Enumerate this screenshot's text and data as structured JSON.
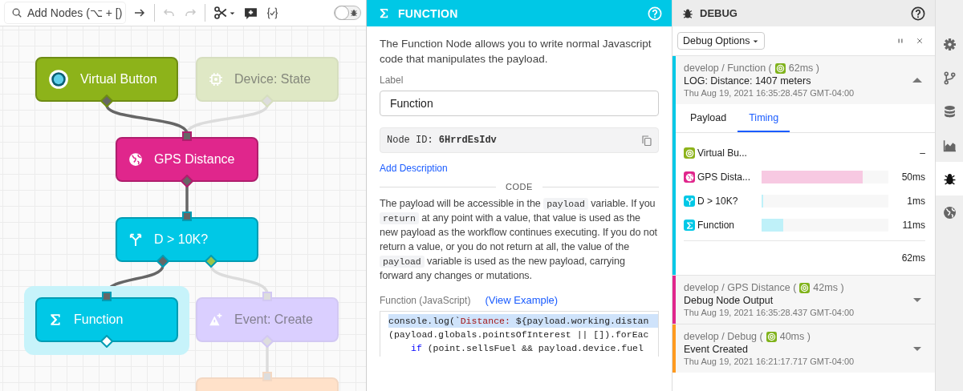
{
  "toolbar": {
    "search": {
      "placeholder": "Add Nodes (⌥ + [)"
    },
    "undo": {
      "disabled": true
    },
    "redo": {
      "disabled": true
    },
    "debug_toggle": {
      "on": false
    }
  },
  "nodes": [
    {
      "label": "Virtual Button",
      "kind": "button",
      "color": "#8db31a",
      "dimmed": false,
      "selected": false
    },
    {
      "label": "Device: State",
      "kind": "device",
      "color": "#dfe8c5",
      "dimmed": true,
      "selected": false
    },
    {
      "label": "GPS Distance",
      "kind": "location",
      "color": "#e0268c",
      "dimmed": false,
      "selected": false
    },
    {
      "label": "D > 10K?",
      "kind": "conditional",
      "color": "#00c8e6",
      "dimmed": false,
      "selected": false
    },
    {
      "label": "Function",
      "kind": "function",
      "color": "#00c8e6",
      "dimmed": false,
      "selected": true
    },
    {
      "label": "Event: Create",
      "kind": "event",
      "color": "#dacfff",
      "dimmed": true,
      "selected": false
    },
    {
      "kind": "other",
      "color": "#ffe1c9",
      "dimmed": true,
      "selected": false
    }
  ],
  "editor": {
    "title": "FUNCTION",
    "description": "The Function Node allows you to write normal Javascript code that manipulates the payload.",
    "label_caption": "Label",
    "label_value": "Function",
    "node_id_caption": "Node ID:",
    "node_id": "6HrrdEsIdv",
    "add_description": "Add Description",
    "section": "CODE",
    "help": [
      {
        "text": "The payload will be accessible in the ",
        "code": false
      },
      {
        "text": "payload",
        "code": true
      },
      {
        "text": " variable. If you ",
        "code": false
      },
      {
        "text": "return",
        "code": true
      },
      {
        "text": " at any point with a value, that value is used as the new payload as the workflow continues executing. If you do not return a value, or you do not return at all, the value of the ",
        "code": false
      },
      {
        "text": "payload",
        "code": true
      },
      {
        "text": " variable is used as the new payload, carrying forward any changes or mutations.",
        "code": false
      }
    ],
    "code_caption": "Function (JavaScript)",
    "view_example": "(View Example)",
    "code_lines": [
      {
        "selected": true,
        "indented": false,
        "tokens": [
          {
            "text": "console.log(`",
            "kind": "plain"
          },
          {
            "text": "Distance: ",
            "kind": "string"
          },
          {
            "text": "${payload.working.distan",
            "kind": "plain"
          }
        ]
      },
      {
        "selected": false,
        "indented": false,
        "tokens": [
          {
            "text": "(payload.globals.pointsOfInterest || []).forEac",
            "kind": "plain"
          }
        ]
      },
      {
        "selected": false,
        "indented": true,
        "tokens": [
          {
            "text": "if",
            "kind": "keyword"
          },
          {
            "text": " (point.sellsFuel && payload.device.fuel",
            "kind": "plain"
          }
        ]
      }
    ]
  },
  "debug": {
    "title": "DEBUG",
    "options_label": "Debug Options",
    "entries": [
      {
        "color": "#00c8e6",
        "source": "develop / Function (",
        "duration": "62ms )",
        "message": "LOG: Distance: 1407 meters",
        "timestamp": "Thu Aug 19, 2021 16:35:28.457 GMT-04:00",
        "expanded": true,
        "tabs": [
          {
            "label": "Payload",
            "selected": false
          },
          {
            "label": "Timing",
            "selected": true
          }
        ],
        "timing": [
          {
            "kind": "button",
            "color": "#8db31a",
            "name": "Virtual Bu...",
            "time": "–"
          },
          {
            "kind": "location",
            "color": "#e0268c",
            "name": "GPS Dista...",
            "time": "50ms",
            "level": 0.8
          },
          {
            "kind": "conditional",
            "color": "#00c8e6",
            "name": "D > 10K?",
            "time": "1ms",
            "level": 0.012
          },
          {
            "kind": "function",
            "color": "#00c8e6",
            "name": "Function",
            "time": "11ms",
            "level": 0.17
          }
        ],
        "total": "62ms"
      },
      {
        "color": "#e0268c",
        "source": "develop / GPS Distance (",
        "duration": "42ms )",
        "message": "Debug Node Output",
        "timestamp": "Thu Aug 19, 2021 16:35:28.437 GMT-04:00",
        "expanded": false
      },
      {
        "color": "#ff9a1f",
        "source": "develop / Debug (",
        "duration": "40ms )",
        "message": "Event Created",
        "timestamp": "Thu Aug 19, 2021 16:21:17.717 GMT-04:00",
        "expanded": false
      }
    ]
  },
  "rail": [
    {
      "kind": "settings",
      "selected": false
    },
    {
      "kind": "branch",
      "selected": false
    },
    {
      "kind": "database",
      "selected": false
    },
    {
      "kind": "chart",
      "selected": false
    },
    {
      "kind": "debug",
      "selected": true
    },
    {
      "kind": "globe",
      "selected": false
    }
  ]
}
